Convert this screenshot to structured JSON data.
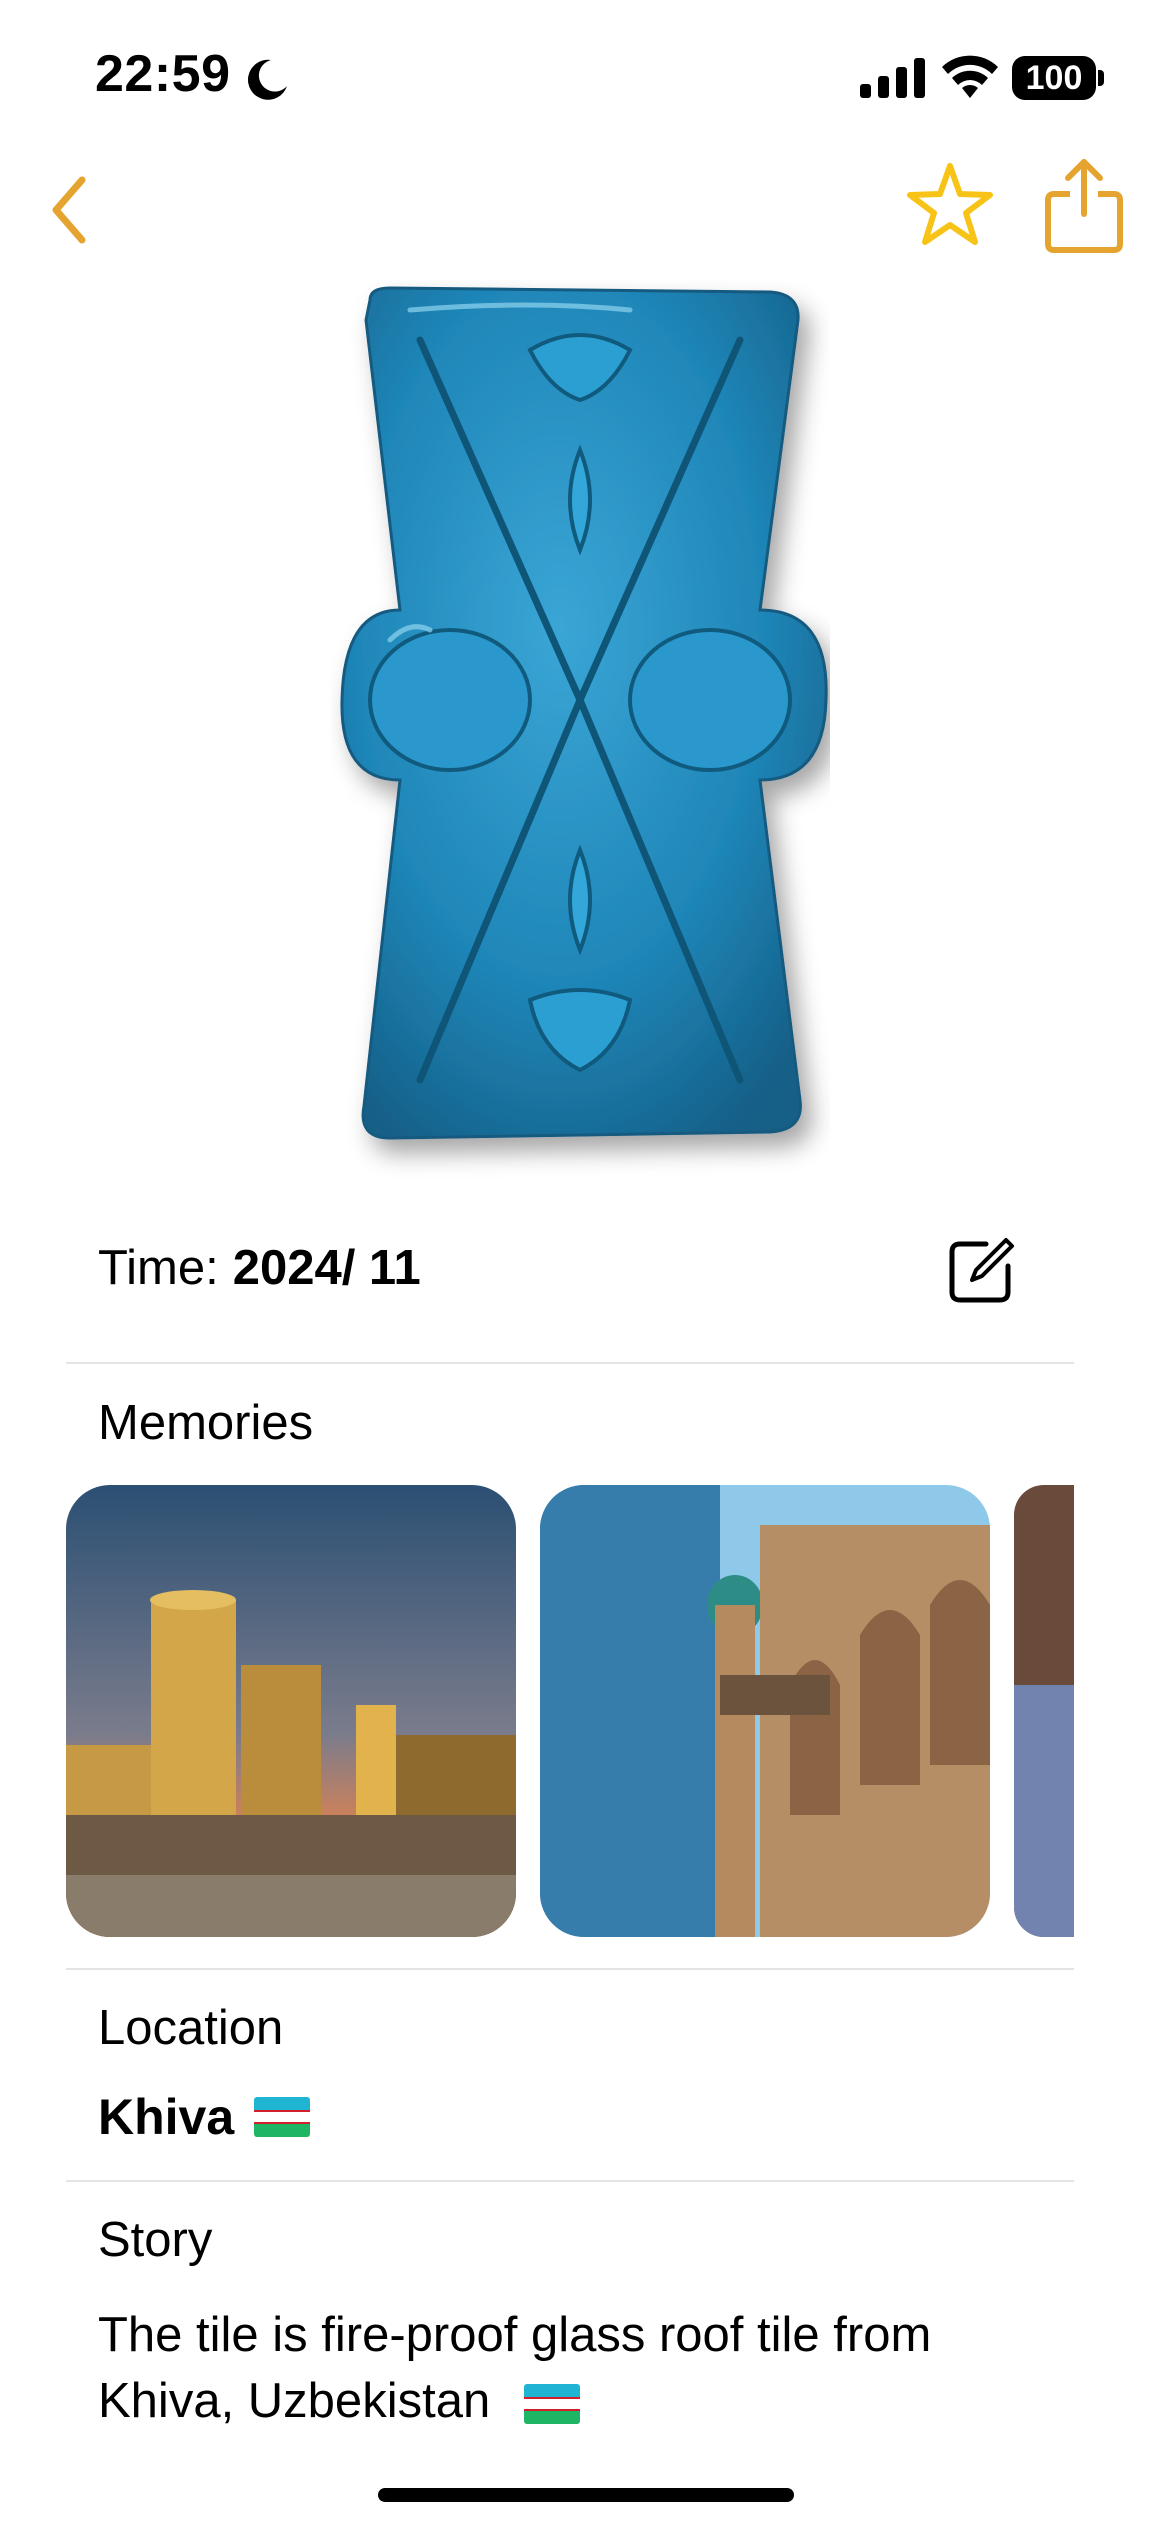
{
  "status_bar": {
    "time": "22:59",
    "battery": "100"
  },
  "colors": {
    "accent": "#E5A430",
    "star": "#F7C316",
    "tile": "#2A93C6"
  },
  "nav": {
    "back_icon": "chevron-left-icon",
    "favorite_icon": "star-icon",
    "share_icon": "share-icon"
  },
  "detail": {
    "time_label": "Time:",
    "time_value": "2024/ 11",
    "memories_title": "Memories",
    "location_title": "Location",
    "location_value": "Khiva",
    "story_title": "Story",
    "story_text": "The tile is fire-proof glass roof tile from Khiva, Uzbekistan"
  }
}
